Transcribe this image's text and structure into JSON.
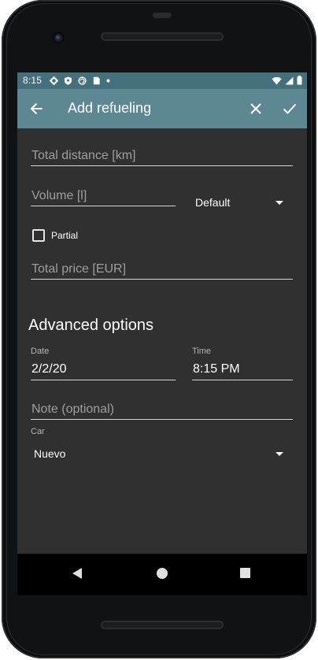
{
  "status_bar": {
    "time": "8:15",
    "left_icons": [
      "gear-icon",
      "shield-icon",
      "sync-icon",
      "sim-icon",
      "dot-icon"
    ],
    "right_icons": [
      "wifi-icon",
      "cell-signal-icon",
      "battery-icon"
    ]
  },
  "app_bar": {
    "title": "Add refueling",
    "icons": {
      "back": "arrow-back-icon",
      "close": "close-icon",
      "confirm": "check-icon"
    },
    "color": "#5d8893"
  },
  "form": {
    "total_distance": {
      "placeholder": "Total distance [km]",
      "value": ""
    },
    "volume": {
      "placeholder": "Volume [l]",
      "value": ""
    },
    "volume_unit": {
      "selected": "Default"
    },
    "partial": {
      "label": "Partial",
      "checked": false
    },
    "total_price": {
      "placeholder": "Total price [EUR]",
      "value": ""
    },
    "advanced_title": "Advanced options",
    "date": {
      "label": "Date",
      "value": "2/2/20"
    },
    "time": {
      "label": "Time",
      "value": "8:15 PM"
    },
    "note": {
      "placeholder": "Note (optional)",
      "value": ""
    },
    "car": {
      "label": "Car",
      "selected": "Nuevo"
    }
  },
  "nav_bar": {
    "icons": [
      "nav-back-icon",
      "nav-home-icon",
      "nav-recents-icon"
    ]
  },
  "colors": {
    "background": "#303030",
    "status_bar": "#43707b",
    "app_bar": "#5d8893"
  }
}
